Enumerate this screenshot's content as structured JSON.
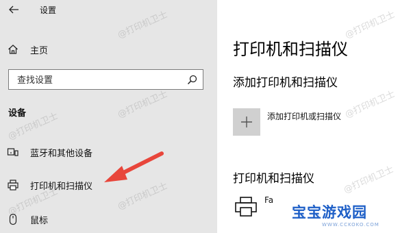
{
  "window": {
    "title": "设置",
    "back_icon": "arrow-left-icon"
  },
  "sidebar": {
    "home": {
      "label": "主页",
      "icon": "home-icon"
    },
    "search": {
      "placeholder": "查找设置",
      "icon": "search-icon"
    },
    "section_title": "设备",
    "items": [
      {
        "label": "蓝牙和其他设备",
        "icon": "bluetooth-devices-icon"
      },
      {
        "label": "打印机和扫描仪",
        "icon": "printer-icon"
      },
      {
        "label": "鼠标",
        "icon": "mouse-icon"
      }
    ]
  },
  "main": {
    "page_title": "打印机和扫描仪",
    "add_section_title": "添加打印机和扫描仪",
    "add_button_label": "添加打印机或扫描仪",
    "list_title": "打印机和扫描仪",
    "printers": [
      {
        "name": "Fa"
      }
    ]
  },
  "watermark": {
    "text": "@打印机卫士"
  },
  "branding": {
    "name": "宝宝游戏园",
    "url": "WWW.CCKOKO.COM"
  },
  "colors": {
    "sidebar_bg": "#e6e6e6",
    "arrow": "#e8463b",
    "brand": "#1e5fc7"
  }
}
